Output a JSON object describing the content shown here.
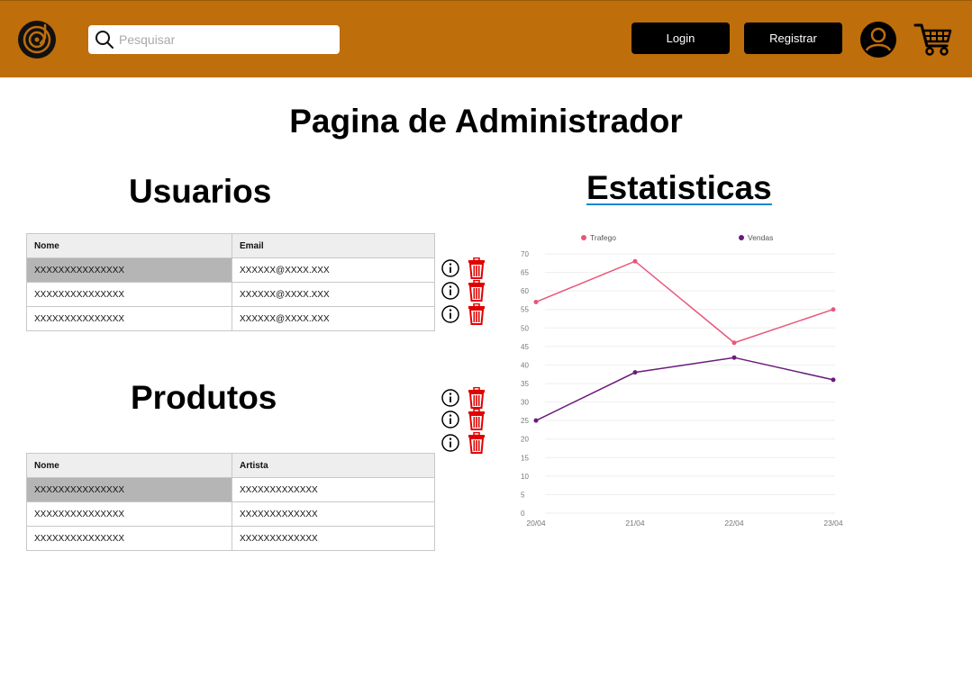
{
  "header": {
    "search_placeholder": "Pesquisar",
    "login_label": "Login",
    "register_label": "Registrar",
    "bar_color": "#be6e0b",
    "icons": [
      "vinyl-record-icon",
      "search-icon",
      "user-avatar-icon",
      "shopping-cart-icon"
    ]
  },
  "page": {
    "title": "Pagina de Administrador"
  },
  "users": {
    "title": "Usuarios",
    "columns": [
      "Nome",
      "Email"
    ],
    "rows": [
      [
        "XXXXXXXXXXXXXXX",
        "XXXXXX@XXXX.XXX"
      ],
      [
        "XXXXXXXXXXXXXXX",
        "XXXXXX@XXXX.XXX"
      ],
      [
        "XXXXXXXXXXXXXXX",
        "XXXXXX@XXXX.XXX"
      ]
    ]
  },
  "products": {
    "title": "Produtos",
    "columns": [
      "Nome",
      "Artista"
    ],
    "rows": [
      [
        "XXXXXXXXXXXXXXX",
        "XXXXXXXXXXXXX"
      ],
      [
        "XXXXXXXXXXXXXXX",
        "XXXXXXXXXXXXX"
      ],
      [
        "XXXXXXXXXXXXXXX",
        "XXXXXXXXXXXXX"
      ]
    ]
  },
  "stats": {
    "title": "Estatisticas"
  },
  "actions": {
    "icons": [
      "info-icon",
      "trash-icon"
    ],
    "trash_color": "#e00000"
  },
  "chart_data": {
    "type": "line",
    "categories": [
      "20/04",
      "21/04",
      "22/04",
      "23/04"
    ],
    "series": [
      {
        "name": "Trafego",
        "values": [
          57,
          68,
          46,
          55
        ],
        "color": "#e8567a"
      },
      {
        "name": "Vendas",
        "values": [
          25,
          38,
          42,
          36
        ],
        "color": "#6a1b7a"
      }
    ],
    "ylim": [
      0,
      70
    ],
    "yticks": [
      0,
      5,
      10,
      15,
      20,
      25,
      30,
      35,
      40,
      45,
      50,
      55,
      60,
      65,
      70
    ],
    "grid": true,
    "legend": "top"
  }
}
